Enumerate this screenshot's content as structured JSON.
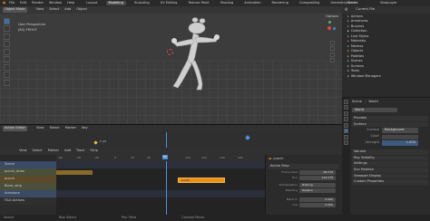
{
  "menu": [
    "File",
    "Edit",
    "Render",
    "Window",
    "Help"
  ],
  "workspaces": [
    {
      "label": "Layout",
      "active": false
    },
    {
      "label": "Modeling",
      "active": true
    },
    {
      "label": "Sculpting",
      "active": false
    },
    {
      "label": "UV Editing",
      "active": false
    },
    {
      "label": "Texture Paint",
      "active": false
    },
    {
      "label": "Shading",
      "active": false
    },
    {
      "label": "Animation",
      "active": false
    },
    {
      "label": "Rendering",
      "active": false
    },
    {
      "label": "Compositing",
      "active": false
    },
    {
      "label": "Geometry Nodes",
      "active": false
    }
  ],
  "scene": {
    "name": "Scene",
    "view_layer": "ViewLayer"
  },
  "viewport": {
    "mode": "Object Mode",
    "menus": [
      "View",
      "Select",
      "Add",
      "Object"
    ],
    "overlay_title": "User Perspective",
    "overlay_sub": "(82) FROOT",
    "right_menu": "Options"
  },
  "outliner": {
    "title": "Current File",
    "items": [
      "Actions",
      "Armatures",
      "Brushes",
      "Collection",
      "Line Styles",
      "Materials",
      "Meshes",
      "Objects",
      "Palettes",
      "Scenes",
      "Screens",
      "Texts",
      "Window Managers"
    ]
  },
  "properties": {
    "breadcrumb": [
      "Scene",
      "World"
    ],
    "world_name": "World",
    "preview": "Preview",
    "surface": "Surface",
    "surface_label": "Surface",
    "surface_value": "Background",
    "color_label": "Color",
    "strength_label": "Strength",
    "strength_value": "1.000",
    "sections": [
      "Volume",
      "Ray Visibility",
      "Settings",
      "Sun Position",
      "Viewport Display",
      "Custom Properties"
    ]
  },
  "timeline": {
    "editor": "Action Editor",
    "menus": [
      "View",
      "Select",
      "Marker",
      "Key"
    ],
    "mid_menus": [
      "Add",
      "Track",
      "Strip"
    ],
    "current_frame": "82",
    "marker": "F_23",
    "ruler": [
      "-60",
      "-40",
      "-20",
      "0",
      "20",
      "40",
      "60",
      "80",
      "100",
      "120",
      "140",
      "160"
    ],
    "tracks": [
      "Scene",
      "punch_draw",
      "punch",
      "Bone_strip",
      "Armature",
      "F&G Actions"
    ],
    "strip_label": "punch"
  },
  "strip_panel": {
    "title": "punch",
    "section": "Active Strip",
    "rows": [
      {
        "label": "Frame Start",
        "value": "96.578"
      },
      {
        "label": "End",
        "value": "122.578"
      }
    ],
    "extrapolation_label": "Extrapolation",
    "extrapolation_value": "Nothing",
    "blending_label": "Blending",
    "blending_value": "Replace",
    "blend_in_label": "Blend In",
    "blend_in_value": "0.000",
    "blend_out_label": "Out",
    "blend_out_value": "0.000"
  },
  "statusbar": [
    "Select",
    "Box Select",
    "Pan View",
    "Context Menu"
  ],
  "colors": {
    "accent": "#4772b3",
    "strip": "#e8921a",
    "playhead": "#4f8fd8",
    "marker": "#e8c34a"
  }
}
